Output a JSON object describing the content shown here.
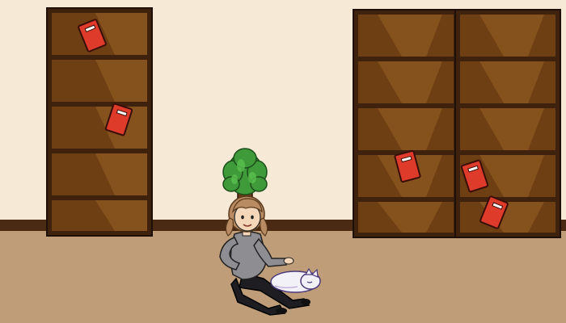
{
  "scene": {
    "type": "storyboard-panel",
    "setting": "library",
    "colors": {
      "wall": "#F6EAD7",
      "baseboard": "#4A2A12",
      "floor": "#BE9D78",
      "shelf_dark": "#3E220E",
      "shelf_mid": "#6E3F12",
      "shelf_light": "#8A5A24",
      "book": "#DE3B2A",
      "plant_leaf": "#3F9A3A",
      "shirt": "#8E8E92",
      "pants": "#1E1E22",
      "hair": "#B88B62",
      "skin": "#F4D6B8",
      "cat": "#F3F1F8"
    },
    "objects": [
      {
        "name": "bookshelf-left",
        "icon": "bookshelf",
        "shelves": 5
      },
      {
        "name": "bookshelf-right-a",
        "icon": "bookshelf",
        "shelves": 5
      },
      {
        "name": "bookshelf-right-b",
        "icon": "bookshelf",
        "shelves": 5
      },
      {
        "name": "potted-plant",
        "icon": "plant"
      },
      {
        "name": "girl-character",
        "icon": "person-sitting"
      },
      {
        "name": "sleeping-cat",
        "icon": "cat"
      }
    ],
    "books": [
      {
        "name": "book-1",
        "color": "#DE3B2A"
      },
      {
        "name": "book-2",
        "color": "#DE3B2A"
      },
      {
        "name": "book-3",
        "color": "#DE3B2A"
      },
      {
        "name": "book-4",
        "color": "#DE3B2A"
      },
      {
        "name": "book-5",
        "color": "#DE3B2A"
      }
    ]
  }
}
